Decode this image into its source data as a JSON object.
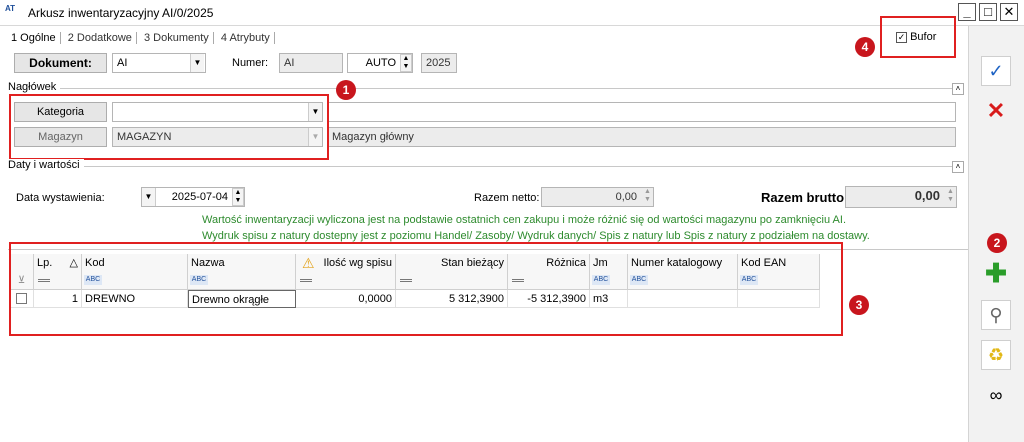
{
  "window": {
    "title": "Arkusz inwentaryzacyjny AI/0/2025",
    "app_icon": "AT"
  },
  "tabs": [
    {
      "label": "1 Ogólne"
    },
    {
      "label": "2 Dodatkowe"
    },
    {
      "label": "3 Dokumenty"
    },
    {
      "label": "4 Atrybuty"
    }
  ],
  "bufor": {
    "label": "Bufor",
    "checked": true
  },
  "document": {
    "button_label": "Dokument:",
    "type_value": "AI",
    "number_label": "Numer:",
    "number_prefix": "AI",
    "auto_value": "AUTO",
    "year": "2025"
  },
  "header_section": {
    "label": "Nagłówek",
    "kategoria_label": "Kategoria",
    "kategoria_value": "",
    "magazyn_label": "Magazyn",
    "magazyn_value": "MAGAZYN",
    "magazyn_name": "Magazyn główny"
  },
  "dates_section": {
    "label": "Daty i wartości",
    "date_label": "Data wystawienia:",
    "date_value": "2025-07-04",
    "netto_label": "Razem netto:",
    "netto_value": "0,00",
    "brutto_label": "Razem brutto:",
    "brutto_value": "0,00",
    "info_line1": "Wartość inwentaryzacji wyliczona jest na podstawie ostatnich cen zakupu i może różnić się od wartości magazynu po zamknięciu AI.",
    "info_line2": "Wydruk spisu z natury dostepny jest z poziomu Handel/ Zasoby/ Wydruk danych/ Spis z natury lub Spis z natury z podziałem na dostawy."
  },
  "grid": {
    "columns": [
      "Lp.",
      "Kod",
      "Nazwa",
      "Ilość wg spisu",
      "Stan bieżący",
      "Różnica",
      "Jm",
      "Numer katalogowy",
      "Kod EAN"
    ],
    "sort_indicator": "△",
    "rows": [
      {
        "lp": "1",
        "kod": "DREWNO",
        "nazwa": "Drewno okrągłe",
        "ilosc": "0,0000",
        "stan": "5 312,3900",
        "roznica": "-5 312,3900",
        "jm": "m3",
        "numer": "",
        "ean": ""
      }
    ]
  },
  "badges": [
    "1",
    "2",
    "3",
    "4"
  ],
  "toolbar": {
    "save_icon": "save-icon",
    "cancel_icon": "cancel-icon",
    "add_icon": "add-icon",
    "edit_icon": "edit-icon",
    "delete_icon": "trash-icon",
    "search_icon": "binoculars-icon"
  },
  "colors": {
    "accent_red": "#e02020",
    "badge_red": "#c8161d",
    "info_green": "#2e8b2e",
    "plus_green": "#2a9d2a"
  }
}
